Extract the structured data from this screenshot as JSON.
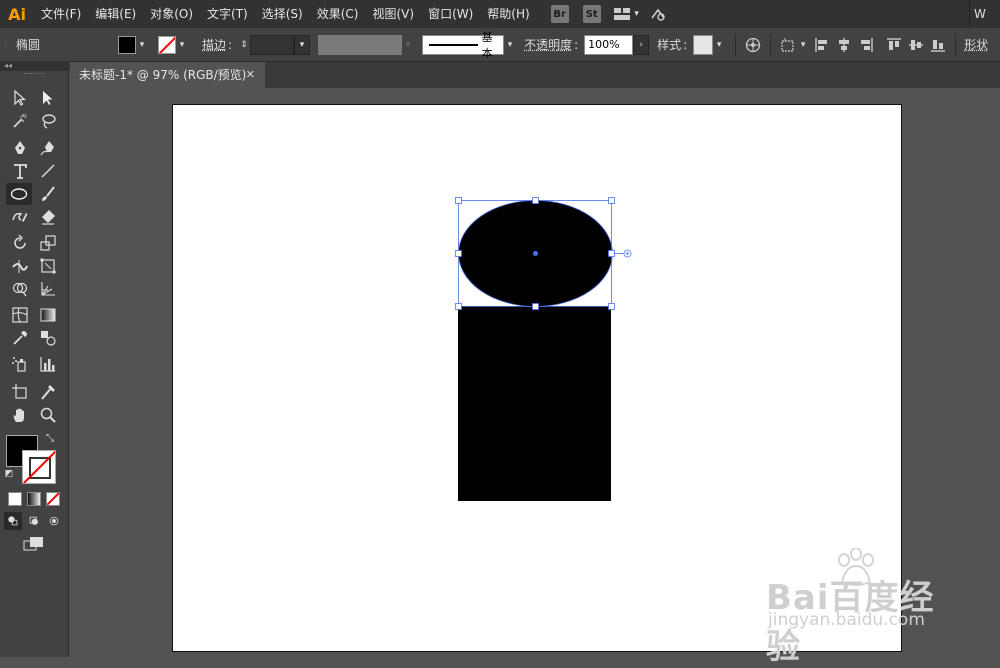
{
  "app": {
    "logo": "Ai",
    "workspace_short": "W"
  },
  "menu": [
    "文件(F)",
    "编辑(E)",
    "对象(O)",
    "文字(T)",
    "选择(S)",
    "效果(C)",
    "视图(V)",
    "窗口(W)",
    "帮助(H)"
  ],
  "menu_badges": {
    "bridge": "Br",
    "stock": "St"
  },
  "control": {
    "shape_name": "椭圆",
    "stroke_label": "描边",
    "stroke_style": "基本",
    "opacity_label": "不透明度",
    "opacity_value": "100%",
    "style_label": "样式",
    "shape_label": "形状"
  },
  "document": {
    "tab_title": "未标题-1* @ 97% (RGB/预览)",
    "close_glyph": "✕"
  },
  "watermark": {
    "main": "Bai百度经验",
    "sub": "jingyan.baidu.com"
  },
  "colors": {
    "fill": "#000000",
    "selection": "#4a73e8",
    "accent": "#ff9a00"
  }
}
